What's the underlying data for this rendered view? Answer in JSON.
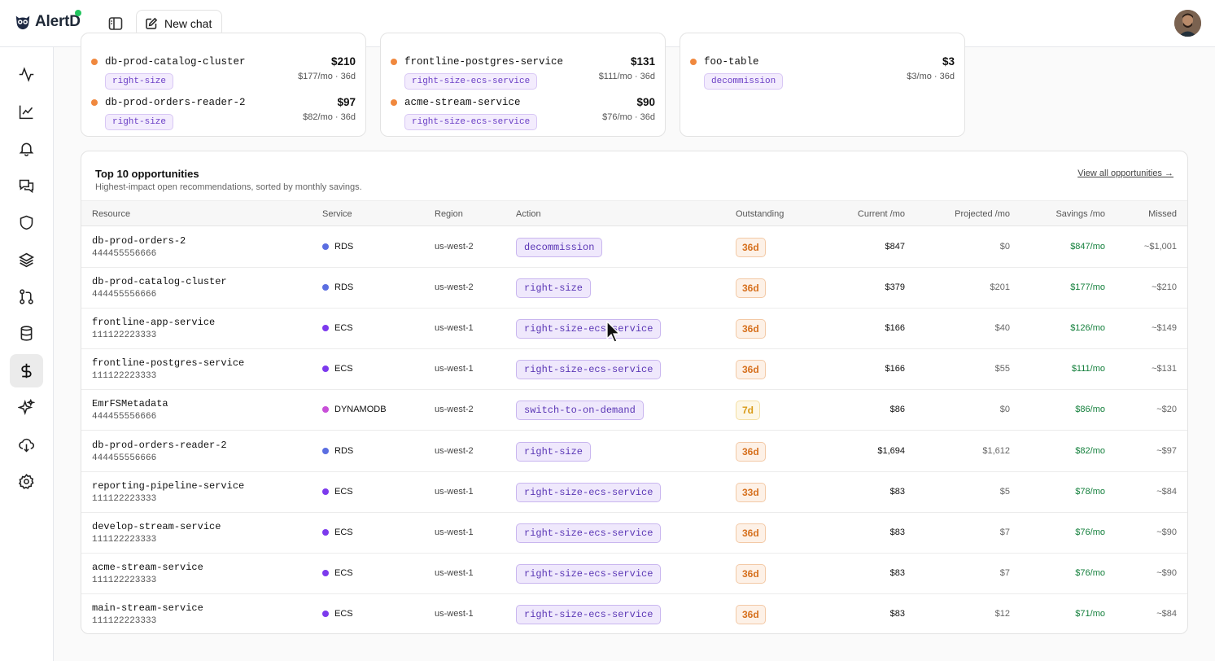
{
  "app": {
    "name": "AlertD",
    "new_chat_label": "New chat"
  },
  "sidebar": {
    "items": [
      {
        "name": "activity",
        "icon": "activity-icon"
      },
      {
        "name": "charts",
        "icon": "line-chart-icon"
      },
      {
        "name": "alerts",
        "icon": "bell-icon"
      },
      {
        "name": "chats",
        "icon": "messages-icon"
      },
      {
        "name": "security",
        "icon": "shield-icon"
      },
      {
        "name": "layers",
        "icon": "layers-icon"
      },
      {
        "name": "pull-requests",
        "icon": "git-pull-request-icon"
      },
      {
        "name": "databases",
        "icon": "database-icon"
      },
      {
        "name": "cost",
        "icon": "dollar-icon",
        "active": true
      },
      {
        "name": "ai",
        "icon": "sparkles-icon"
      },
      {
        "name": "cloud-download",
        "icon": "cloud-download-icon"
      },
      {
        "name": "settings",
        "icon": "gear-icon"
      }
    ]
  },
  "summary_cards": [
    {
      "items": [
        {
          "name": "db-prod-catalog-cluster",
          "tag": "right-size",
          "amount": "$210",
          "sub": "$177/mo · 36d"
        },
        {
          "name": "db-prod-orders-reader-2",
          "tag": "right-size",
          "amount": "$97",
          "sub": "$82/mo · 36d"
        }
      ]
    },
    {
      "items": [
        {
          "name": "frontline-postgres-service",
          "tag": "right-size-ecs-service",
          "amount": "$131",
          "sub": "$111/mo · 36d"
        },
        {
          "name": "acme-stream-service",
          "tag": "right-size-ecs-service",
          "amount": "$90",
          "sub": "$76/mo · 36d"
        }
      ]
    },
    {
      "items": [
        {
          "name": "foo-table",
          "tag": "decommission",
          "amount": "$3",
          "sub": "$3/mo · 36d"
        }
      ]
    }
  ],
  "opportunities": {
    "title": "Top 10 opportunities",
    "subtitle": "Highest-impact open recommendations, sorted by monthly savings.",
    "view_all": "View all opportunities →",
    "columns": [
      "Resource",
      "Service",
      "Region",
      "Action",
      "Outstanding",
      "Current /mo",
      "Projected /mo",
      "Savings /mo",
      "Missed"
    ],
    "service_colors": {
      "RDS": "#5b6ee1",
      "ECS": "#7c3aed",
      "DYNAMODB": "#c850d8"
    },
    "rows": [
      {
        "resource": "db-prod-orders-2",
        "account": "444455556666",
        "service": "RDS",
        "region": "us-west-2",
        "action": "decommission",
        "outstanding": "36d",
        "current": "$847",
        "projected": "$0",
        "savings": "$847/mo",
        "missed": "~$1,001"
      },
      {
        "resource": "db-prod-catalog-cluster",
        "account": "444455556666",
        "service": "RDS",
        "region": "us-west-2",
        "action": "right-size",
        "outstanding": "36d",
        "current": "$379",
        "projected": "$201",
        "savings": "$177/mo",
        "missed": "~$210"
      },
      {
        "resource": "frontline-app-service",
        "account": "111122223333",
        "service": "ECS",
        "region": "us-west-1",
        "action": "right-size-ecs-service",
        "outstanding": "36d",
        "current": "$166",
        "projected": "$40",
        "savings": "$126/mo",
        "missed": "~$149"
      },
      {
        "resource": "frontline-postgres-service",
        "account": "111122223333",
        "service": "ECS",
        "region": "us-west-1",
        "action": "right-size-ecs-service",
        "outstanding": "36d",
        "current": "$166",
        "projected": "$55",
        "savings": "$111/mo",
        "missed": "~$131"
      },
      {
        "resource": "EmrFSMetadata",
        "account": "444455556666",
        "service": "DYNAMODB",
        "region": "us-west-2",
        "action": "switch-to-on-demand",
        "outstanding": "7d",
        "current": "$86",
        "projected": "$0",
        "savings": "$86/mo",
        "missed": "~$20"
      },
      {
        "resource": "db-prod-orders-reader-2",
        "account": "444455556666",
        "service": "RDS",
        "region": "us-west-2",
        "action": "right-size",
        "outstanding": "36d",
        "current": "$1,694",
        "projected": "$1,612",
        "savings": "$82/mo",
        "missed": "~$97"
      },
      {
        "resource": "reporting-pipeline-service",
        "account": "111122223333",
        "service": "ECS",
        "region": "us-west-1",
        "action": "right-size-ecs-service",
        "outstanding": "33d",
        "current": "$83",
        "projected": "$5",
        "savings": "$78/mo",
        "missed": "~$84"
      },
      {
        "resource": "develop-stream-service",
        "account": "111122223333",
        "service": "ECS",
        "region": "us-west-1",
        "action": "right-size-ecs-service",
        "outstanding": "36d",
        "current": "$83",
        "projected": "$7",
        "savings": "$76/mo",
        "missed": "~$90"
      },
      {
        "resource": "acme-stream-service",
        "account": "111122223333",
        "service": "ECS",
        "region": "us-west-1",
        "action": "right-size-ecs-service",
        "outstanding": "36d",
        "current": "$83",
        "projected": "$7",
        "savings": "$76/mo",
        "missed": "~$90"
      },
      {
        "resource": "main-stream-service",
        "account": "111122223333",
        "service": "ECS",
        "region": "us-west-1",
        "action": "right-size-ecs-service",
        "outstanding": "36d",
        "current": "$83",
        "projected": "$12",
        "savings": "$71/mo",
        "missed": "~$84"
      }
    ]
  }
}
